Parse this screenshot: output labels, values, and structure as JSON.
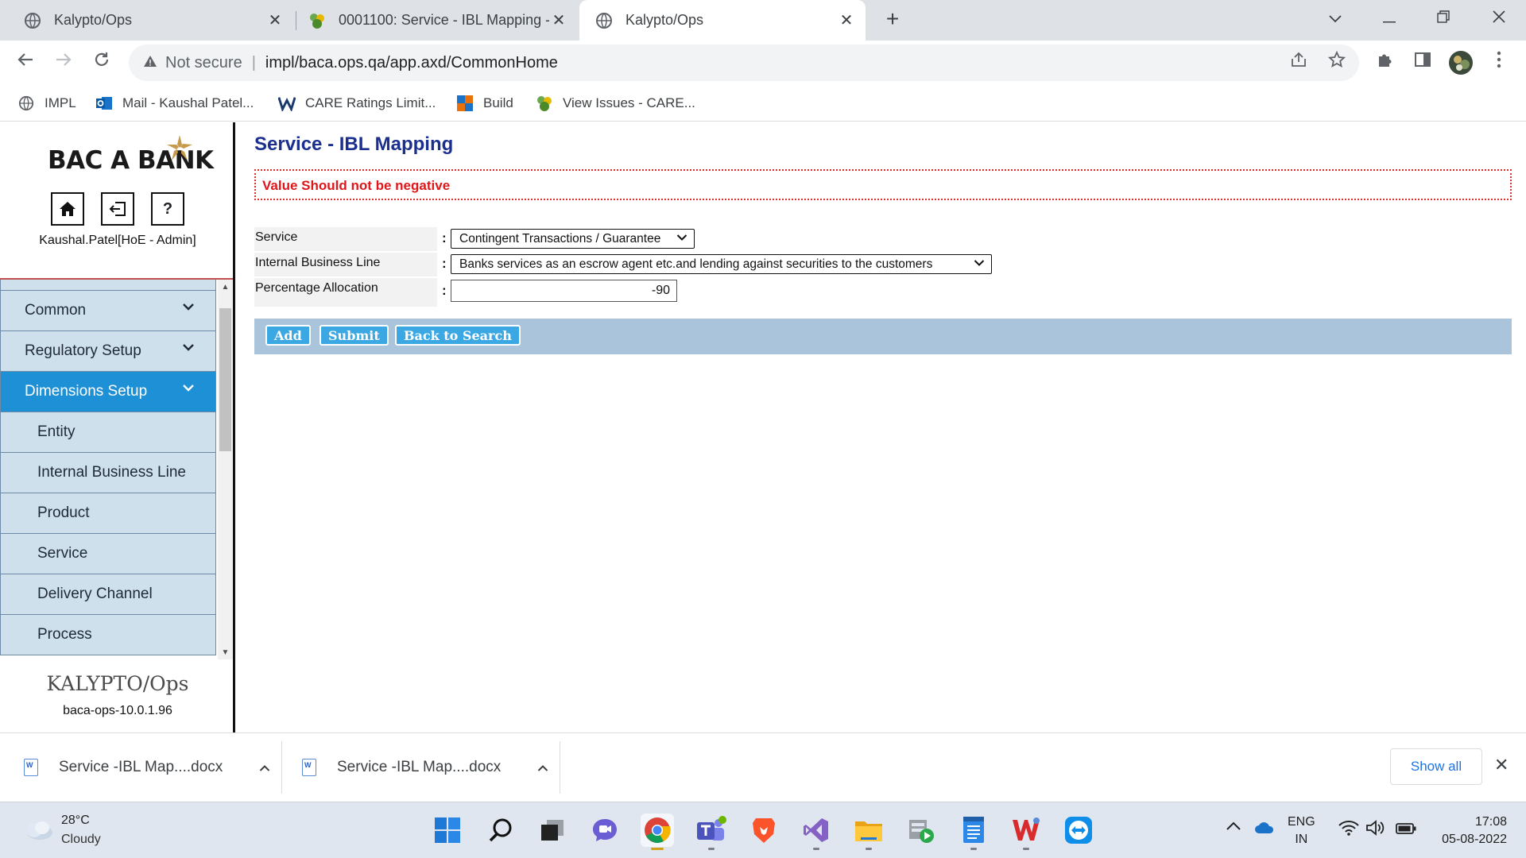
{
  "browser": {
    "tabs": [
      {
        "title": "Kalypto/Ops",
        "close": "✕"
      },
      {
        "title": "0001100: Service - IBL Mapping - ",
        "close": "✕"
      },
      {
        "title": "Kalypto/Ops",
        "close": "✕"
      }
    ],
    "new_tab": "+",
    "omnibox": {
      "security": "Not secure",
      "url": "impl/baca.ops.qa/app.axd/CommonHome"
    },
    "bookmarks": [
      "IMPL",
      "Mail - Kaushal Patel...",
      "CARE Ratings Limit...",
      "Build",
      "View Issues - CARE..."
    ]
  },
  "app": {
    "logo": "BAC A BANK",
    "quick_buttons": {
      "help": "?"
    },
    "user": "Kaushal.Patel[HoE - Admin]",
    "menu": {
      "top_items": [
        "Common",
        "Regulatory Setup",
        "Dimensions Setup"
      ],
      "sub_items": [
        "Entity",
        "Internal Business Line",
        "Product",
        "Service",
        "Delivery Channel",
        "Process"
      ]
    },
    "footer_logo": "KALYPTO/Ops",
    "version": "baca-ops-10.0.1.96"
  },
  "page": {
    "title": "Service - IBL Mapping",
    "error": "Value Should not be negative",
    "form": {
      "service": {
        "label": "Service",
        "value": "Contingent Transactions / Guarantee"
      },
      "ibl": {
        "label": "Internal Business Line",
        "value": "Banks services as an escrow agent etc.and lending against securities to the customers"
      },
      "pct": {
        "label": "Percentage Allocation",
        "value": "-90"
      },
      "colon": ":"
    },
    "buttons": {
      "add": "Add",
      "submit": "Submit",
      "back": "Back to Search"
    }
  },
  "downloads": {
    "items": [
      "Service -IBL Map....docx",
      "Service -IBL Map....docx"
    ],
    "show_all": "Show all",
    "close": "✕"
  },
  "taskbar": {
    "weather": {
      "temp": "28°C",
      "condition": "Cloudy"
    },
    "lang": {
      "line1": "ENG",
      "line2": "IN"
    },
    "clock": {
      "time": "17:08",
      "date": "05-08-2022"
    }
  }
}
